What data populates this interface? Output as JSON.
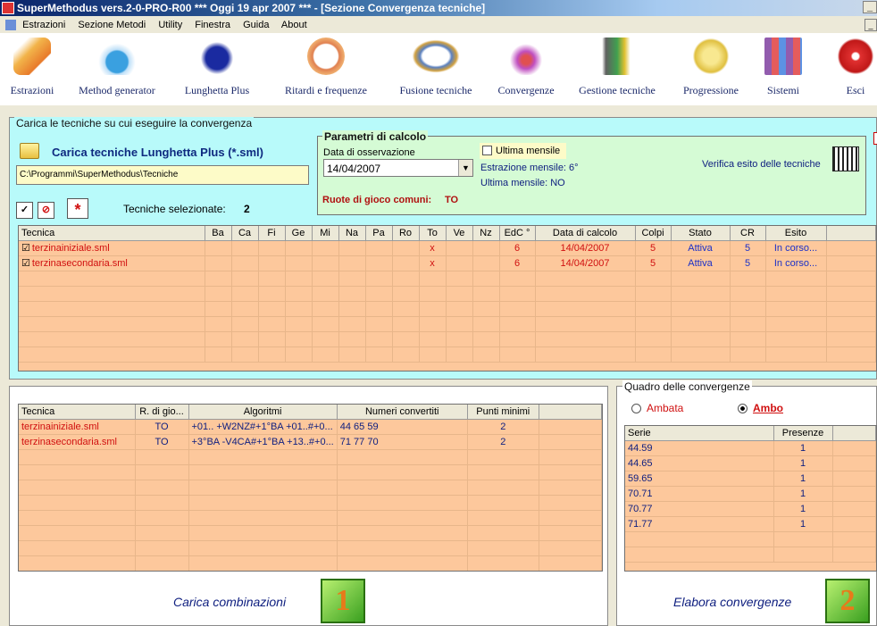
{
  "window": {
    "title": "SuperMethodus vers.2-0-PRO-R00  ***  Oggi 19 apr 2007  ***   - [Sezione Convergenza tecniche]"
  },
  "menu": [
    "Estrazioni",
    "Sezione Metodi",
    "Utility",
    "Finestra",
    "Guida",
    "About"
  ],
  "toolbar": [
    {
      "label": "Estrazioni",
      "icon": "pencil-icon",
      "color": "#e8a040"
    },
    {
      "label": "Method generator",
      "icon": "flask-icon",
      "color": "#3aa0e0"
    },
    {
      "label": "Lunghetta Plus",
      "icon": "rabbit-icon",
      "color": "#2a3ab0"
    },
    {
      "label": "Ritardi e frequenze",
      "icon": "clock-icon",
      "color": "#e08050"
    },
    {
      "label": "Fusione tecniche",
      "icon": "rings-icon",
      "color": "#5a80c0"
    },
    {
      "label": "Convergenze",
      "icon": "arrows-icon",
      "color": "#c050c0"
    },
    {
      "label": "Gestione tecniche",
      "icon": "tools-icon",
      "color": "#40a050"
    },
    {
      "label": "Progressione",
      "icon": "coin-icon",
      "color": "#e0c040"
    },
    {
      "label": "Sistemi",
      "icon": "grid-icon",
      "color": "#8040a0"
    },
    {
      "label": "Esci",
      "icon": "exit-icon",
      "color": "#e03030"
    }
  ],
  "top": {
    "legend": "Carica le tecniche su cui eseguire la convergenza",
    "load_title": "Carica tecniche Lunghetta Plus (*.sml)",
    "path": "C:\\Programmi\\SuperMethodus\\Tecniche",
    "selected_label": "Tecniche selezionate:",
    "selected_count": "2",
    "params": {
      "legend": "Parametri di calcolo",
      "date_label": "Data di osservazione",
      "date_value": "14/04/2007",
      "ultima_mensile_label": "Ultima mensile",
      "estrazione_mensile": "Estrazione mensile: 6°",
      "ultima_mensile_value": "Ultima mensile: NO",
      "ruote_label": "Ruote di gioco comuni:",
      "ruote_value": "TO",
      "verifica": "Verifica esito delle tecniche"
    },
    "columns": [
      "Tecnica",
      "Ba",
      "Ca",
      "Fi",
      "Ge",
      "Mi",
      "Na",
      "Pa",
      "Ro",
      "To",
      "Ve",
      "Nz",
      "EdC °",
      "Data di calcolo",
      "Colpi",
      "Stato",
      "CR",
      "Esito"
    ],
    "rows": [
      [
        "terzinainiziale.sml",
        "",
        "",
        "",
        "",
        "",
        "",
        "",
        "",
        "x",
        "",
        "",
        "6",
        "14/04/2007",
        "5",
        "Attiva",
        "5",
        "In corso..."
      ],
      [
        "terzinasecondaria.sml",
        "",
        "",
        "",
        "",
        "",
        "",
        "",
        "",
        "x",
        "",
        "",
        "6",
        "14/04/2007",
        "5",
        "Attiva",
        "5",
        "In corso..."
      ]
    ]
  },
  "bottom_left": {
    "columns": [
      "Tecnica",
      "R. di gio...",
      "Algoritmi",
      "Numeri convertiti",
      "Punti minimi"
    ],
    "rows": [
      [
        "terzinainiziale.sml",
        "TO",
        "+01.. +W2NZ#+1°BA +01..#+0...",
        "44 65 59",
        "2"
      ],
      [
        "terzinasecondaria.sml",
        "TO",
        "+3°BA -V4CA#+1°BA +13..#+0...",
        "71 77 70",
        "2"
      ]
    ],
    "button": "Carica combinazioni",
    "button_num": "1"
  },
  "bottom_right": {
    "legend": "Quadro delle convergenze",
    "radio_ambata": "Ambata",
    "radio_ambo": "Ambo",
    "columns": [
      "Serie",
      "Presenze"
    ],
    "rows": [
      [
        "44.59",
        "1"
      ],
      [
        "44.65",
        "1"
      ],
      [
        "59.65",
        "1"
      ],
      [
        "70.71",
        "1"
      ],
      [
        "70.77",
        "1"
      ],
      [
        "71.77",
        "1"
      ]
    ],
    "button": "Elabora convergenze",
    "button_num": "2"
  }
}
